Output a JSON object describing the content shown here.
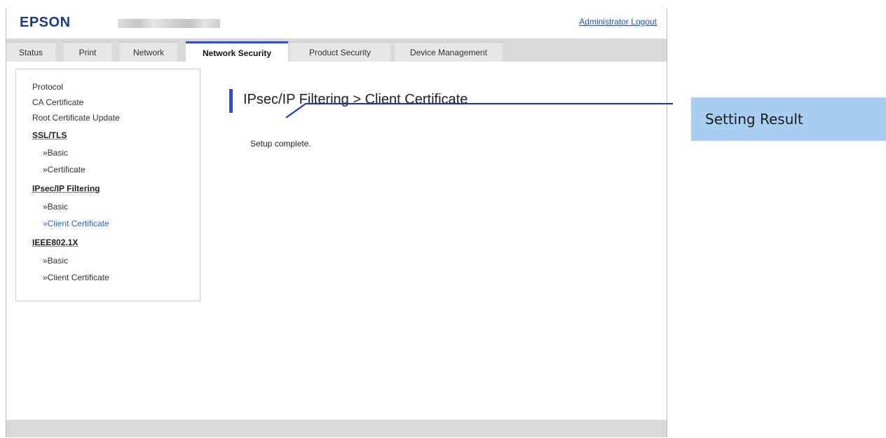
{
  "header": {
    "logo": "EPSON",
    "logout_label": "Administrator Logout"
  },
  "tabs": [
    {
      "label": "Status"
    },
    {
      "label": "Print"
    },
    {
      "label": "Network"
    },
    {
      "label": "Network Security",
      "active": true
    },
    {
      "label": "Product Security"
    },
    {
      "label": "Device Management"
    }
  ],
  "sidebar": {
    "items": [
      {
        "label": "Protocol"
      },
      {
        "label": "CA Certificate"
      },
      {
        "label": "Root Certificate Update"
      },
      {
        "label": "SSL/TLS"
      },
      {
        "label": "»Basic"
      },
      {
        "label": "»Certificate"
      },
      {
        "label": "IPsec/IP Filtering"
      },
      {
        "label": "»Basic"
      },
      {
        "label": "»Client Certificate",
        "current": true
      },
      {
        "label": "IEEE802.1X"
      },
      {
        "label": "»Basic"
      },
      {
        "label": "»Client Certificate"
      }
    ]
  },
  "main": {
    "title": "IPsec/IP Filtering > Client Certificate",
    "message": "Setup complete."
  },
  "callout": {
    "label": "Setting Result",
    "color": "#a8cff2"
  },
  "colors": {
    "accent": "#2d4fd0",
    "brand": "#1a3b8c",
    "link": "#1a50c8"
  }
}
